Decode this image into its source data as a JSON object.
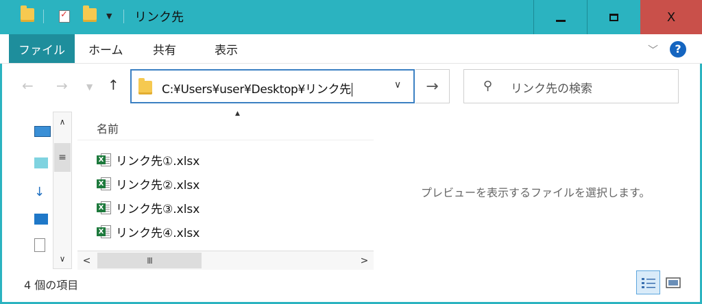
{
  "window": {
    "title": "リンク先",
    "colors": {
      "accent": "#2bb3c0",
      "file_tab": "#1e8e9c",
      "close": "#c9504a"
    }
  },
  "title_controls": {
    "minimize": "minimize",
    "maximize": "maximize",
    "close": "X"
  },
  "ribbon": {
    "tabs": [
      "ファイル",
      "ホーム",
      "共有",
      "表示"
    ],
    "help": "?"
  },
  "nav": {
    "address": "C:¥Users¥user¥Desktop¥リンク先",
    "search_placeholder": "リンク先の検索"
  },
  "list": {
    "column_name": "名前",
    "files": [
      {
        "name": "リンク先①.xlsx",
        "icon": "excel-file-icon"
      },
      {
        "name": "リンク先②.xlsx",
        "icon": "excel-file-icon"
      },
      {
        "name": "リンク先③.xlsx",
        "icon": "excel-file-icon"
      },
      {
        "name": "リンク先④.xlsx",
        "icon": "excel-file-icon"
      }
    ]
  },
  "preview": {
    "message": "プレビューを表示するファイルを選択します。"
  },
  "status": {
    "item_count": "4 個の項目"
  }
}
